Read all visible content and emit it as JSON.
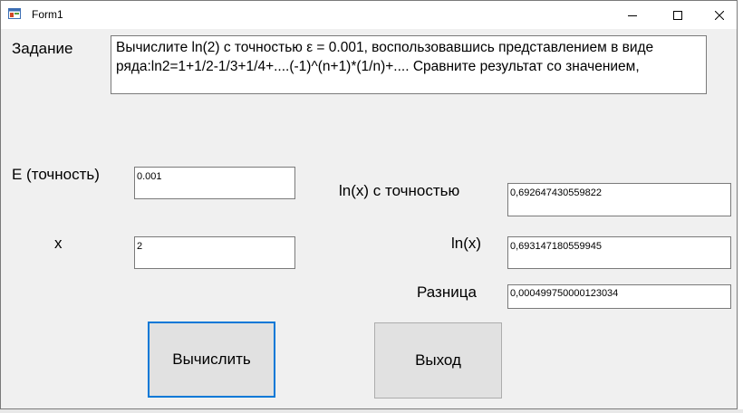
{
  "window": {
    "title": "Form1",
    "controls": [
      "minimize-icon",
      "maximize-icon",
      "close-icon"
    ]
  },
  "task": {
    "label": "Задание",
    "text": "Вычислите ln(2) с точностью ε = 0.001, воспользовавшись представлением в виде ряда:ln2=1+1/2-1/3+1/4+....(-1)^(n+1)*(1/n)+.... Сравните результат со значением,"
  },
  "inputs": {
    "epsilon_label": "Е (точность)",
    "epsilon_value": "0.001",
    "x_label": "x",
    "x_value": "2"
  },
  "results": {
    "approx_label": "ln(x) с  точностью",
    "approx_value": "0,692647430559822",
    "exact_label": "ln(x)",
    "exact_value": "0,693147180559945",
    "diff_label": "Разница",
    "diff_value": "0,000499750000123034"
  },
  "buttons": {
    "compute_label": "Вычислить",
    "exit_label": "Выход"
  },
  "colors": {
    "form_background": "#f0f0f0",
    "focus_border": "#0078d7",
    "button_background": "#e1e1e1"
  }
}
